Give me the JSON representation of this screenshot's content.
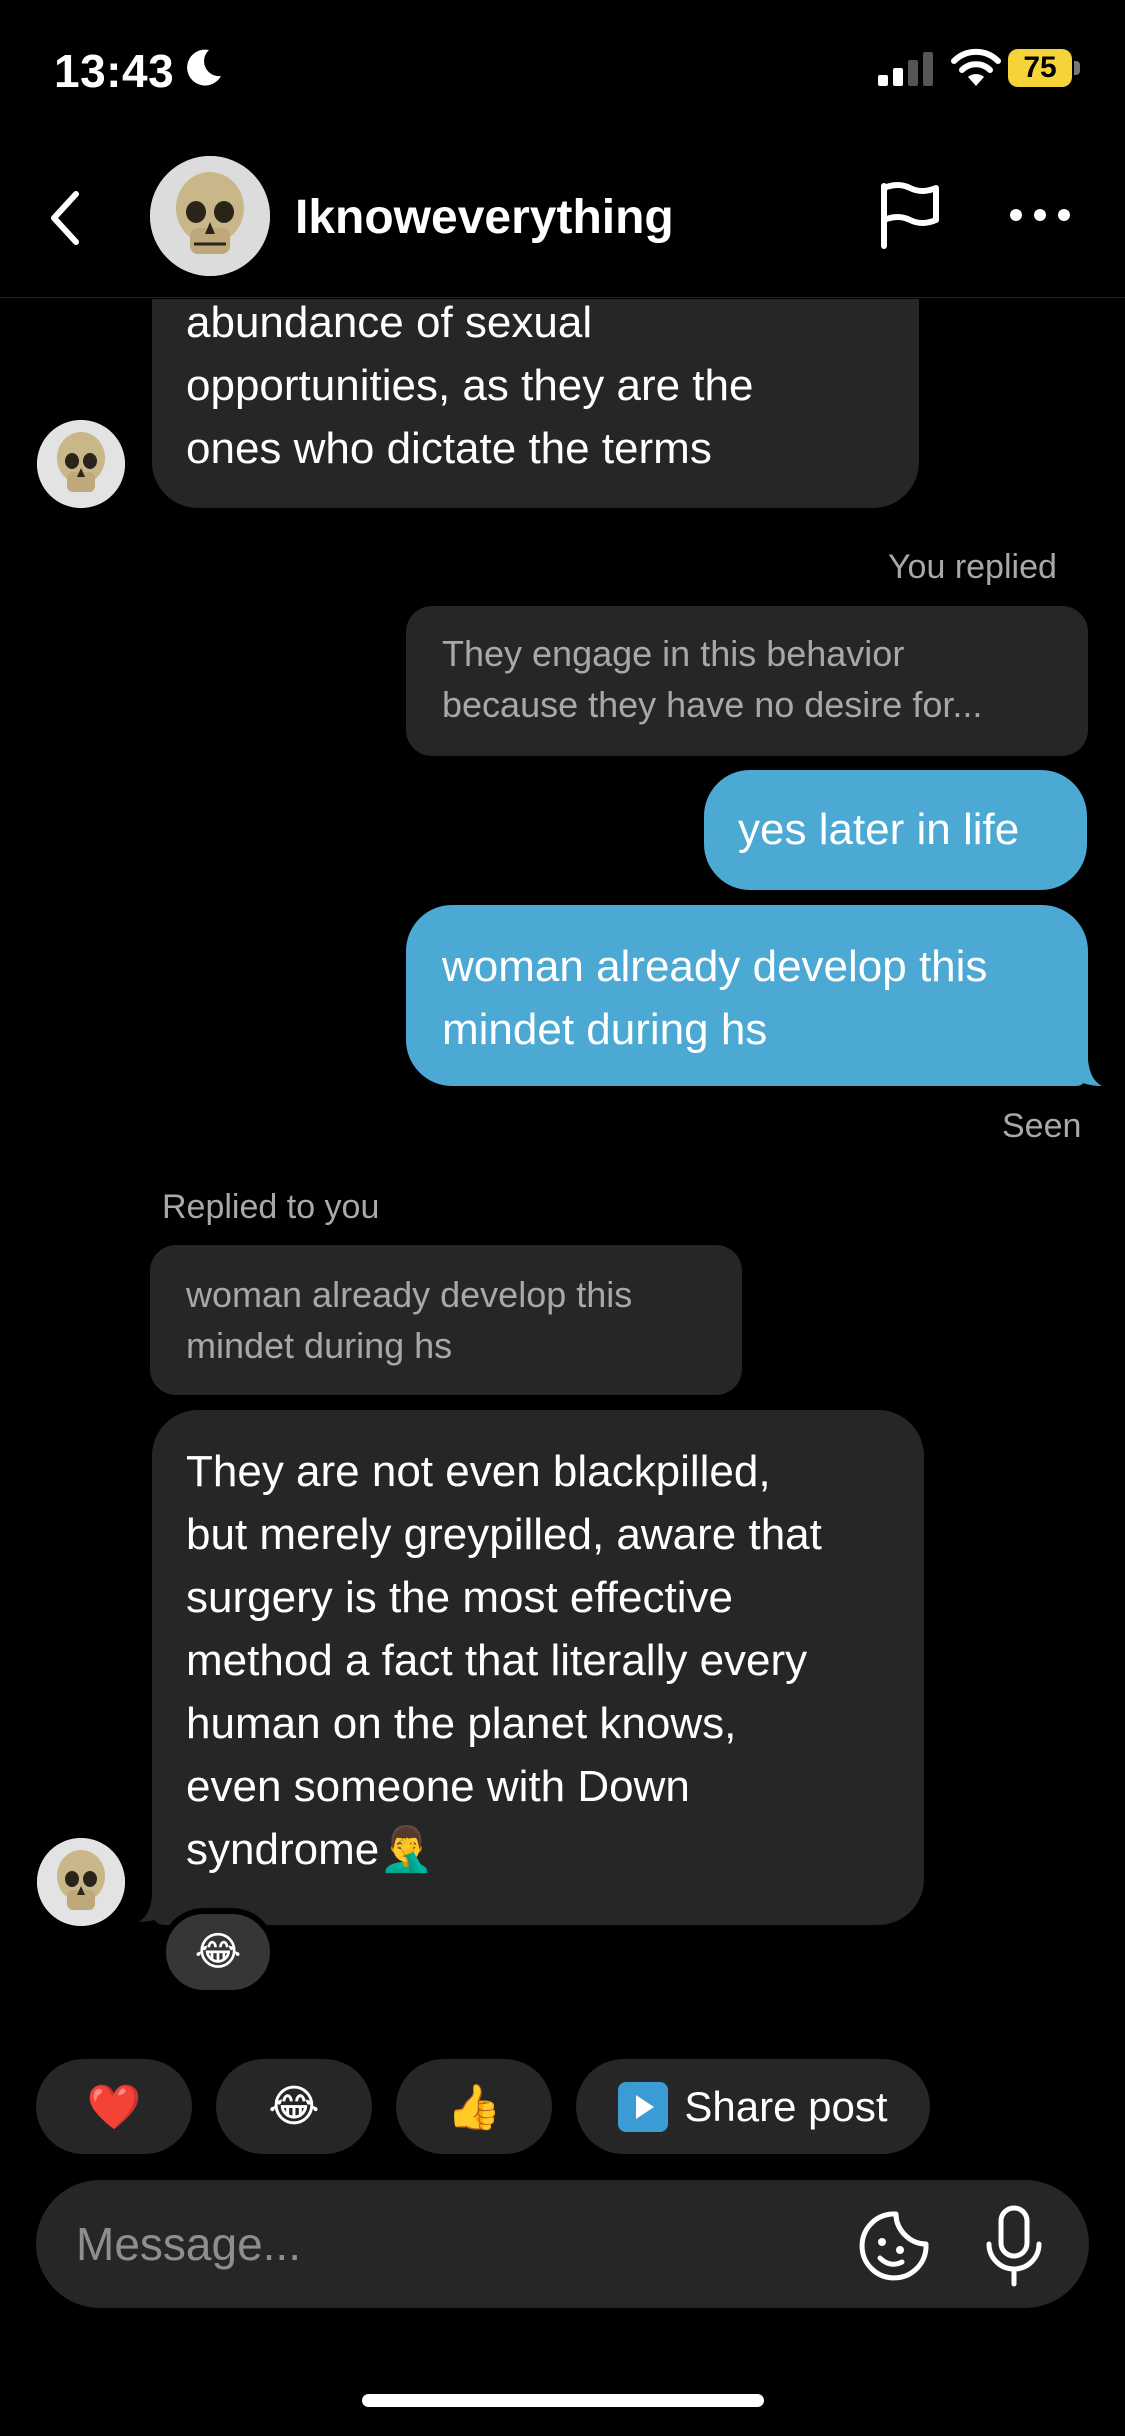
{
  "status_bar": {
    "time": "13:43",
    "battery": "75"
  },
  "header": {
    "username": "Iknoweverything"
  },
  "messages": {
    "m1_lines": [
      "abundance of sexual",
      "opportunities, as they are the",
      "ones who dictate the terms"
    ],
    "you_replied_label": "You replied",
    "quote1_lines": [
      "They engage in this behavior",
      "because they have no desire for..."
    ],
    "m2": "yes later in life",
    "m3_lines": [
      "woman already develop this",
      "mindet during hs"
    ],
    "seen": "Seen",
    "replied_to_you_label": "Replied to you",
    "quote2_lines": [
      "woman already develop this",
      "mindet during hs"
    ],
    "m4_lines": [
      "They are not even blackpilled,",
      "but merely greypilled, aware that",
      "surgery is the most effective",
      "method a fact that literally every",
      "human on the planet knows,",
      "even someone with Down",
      "syndrome🤦‍♂️"
    ],
    "reaction": "😂"
  },
  "quick_replies": {
    "heart": "❤️",
    "laugh": "😂",
    "thumbs": "👍",
    "share_label": "Share post"
  },
  "composer": {
    "placeholder": "Message..."
  },
  "colors": {
    "accent_bubble": "#4ba9d3",
    "incoming_bubble": "#262626",
    "battery": "#f5d43a"
  },
  "icons": [
    "moon-icon",
    "signal-icon",
    "wifi-icon",
    "battery-icon",
    "back-icon",
    "flag-icon",
    "more-icon",
    "play-icon",
    "sticker-icon",
    "microphone-icon"
  ]
}
